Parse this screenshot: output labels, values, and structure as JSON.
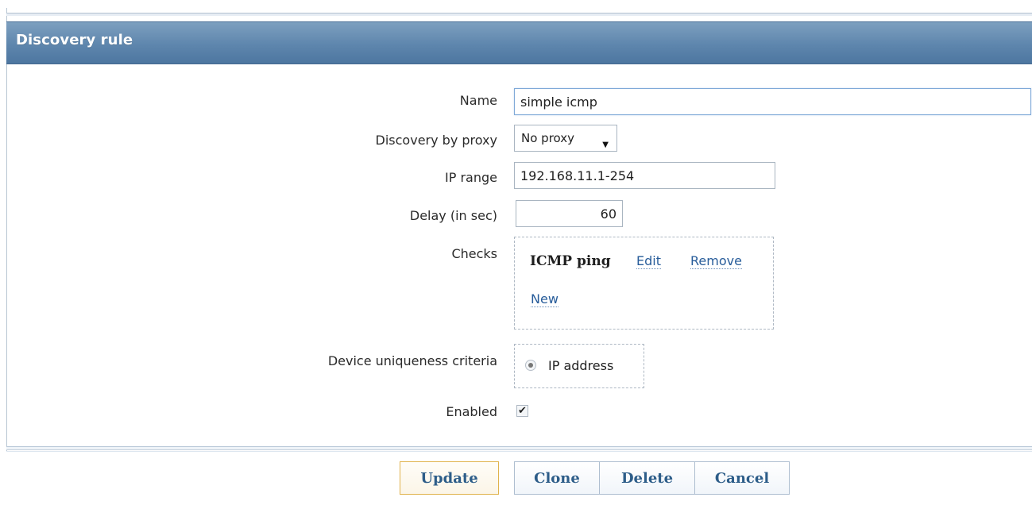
{
  "window": {
    "title": "Discovery rule"
  },
  "form": {
    "name_label": "Name",
    "name_value": "simple icmp",
    "proxy_label": "Discovery by proxy",
    "proxy_value": "No proxy",
    "ip_range_label": "IP range",
    "ip_range_value": "192.168.11.1-254",
    "delay_label": "Delay (in sec)",
    "delay_value": "60",
    "checks_label": "Checks",
    "checks": {
      "item_name": "ICMP ping",
      "edit_label": "Edit",
      "remove_label": "Remove",
      "new_label": "New"
    },
    "uniqueness_label": "Device uniqueness criteria",
    "uniqueness_option": "IP address",
    "enabled_label": "Enabled",
    "enabled_checked": true
  },
  "footer": {
    "update_label": "Update",
    "clone_label": "Clone",
    "delete_label": "Delete",
    "cancel_label": "Cancel"
  },
  "icons": {
    "dropdown": "chevron-down-icon",
    "radio": "radio-selected-icon",
    "checkbox": "check-icon"
  },
  "colors": {
    "header_bg": "#5f87ae",
    "button_text": "#2d5d89",
    "primary_button_border": "#e0b34d",
    "link_color": "#275c9a"
  }
}
